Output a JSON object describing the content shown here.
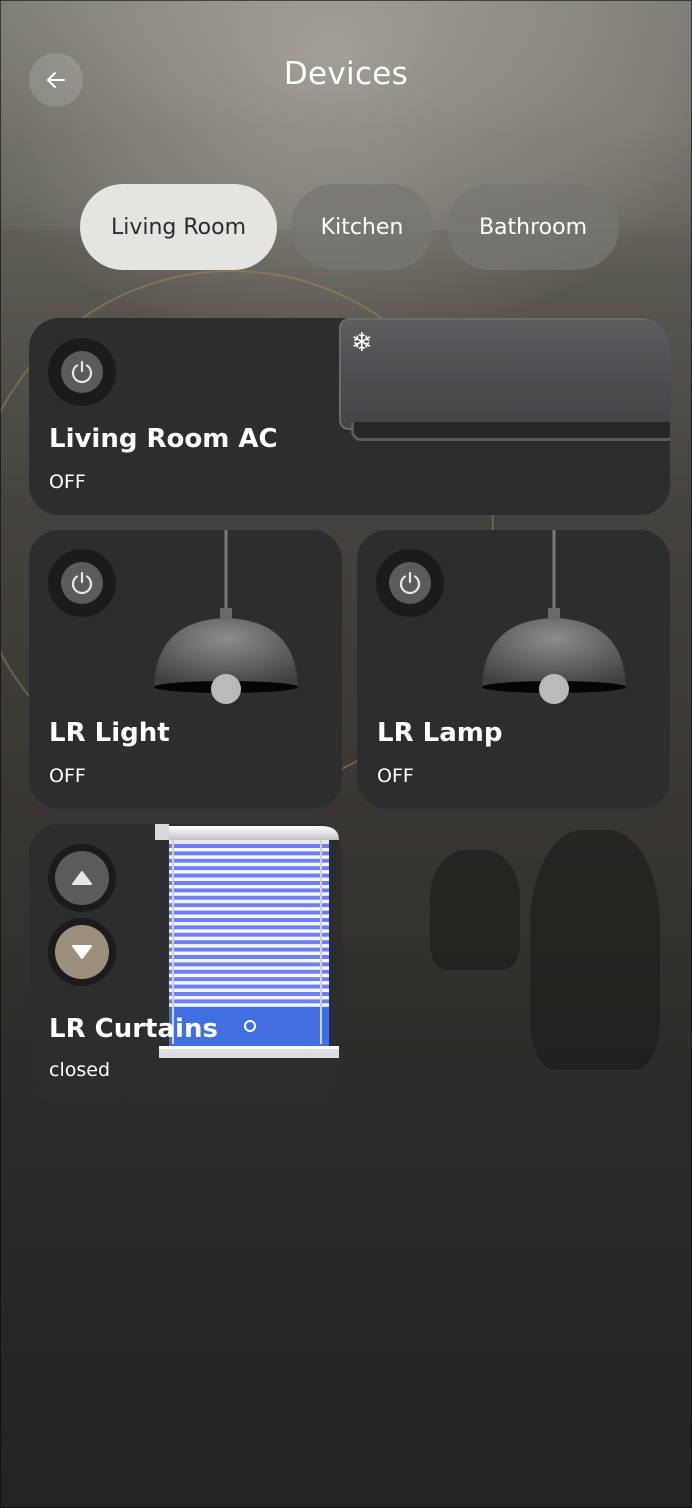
{
  "header": {
    "title": "Devices"
  },
  "tabs": [
    {
      "label": "Living Room",
      "active": true
    },
    {
      "label": "Kitchen",
      "active": false
    },
    {
      "label": "Bathroom",
      "active": false
    }
  ],
  "devices": {
    "ac": {
      "name": "Living Room AC",
      "state": "OFF",
      "icon": "snowflake-icon"
    },
    "light": {
      "name": "LR Light",
      "state": "OFF",
      "icon": "pendant-lamp-icon"
    },
    "lamp": {
      "name": "LR Lamp",
      "state": "OFF",
      "icon": "pendant-lamp-icon"
    },
    "curtains": {
      "name": "LR Curtains",
      "state": "closed",
      "icon": "window-blind-icon"
    }
  },
  "colors": {
    "card": "#2c2d2f",
    "active_tab": "#e6e4e0",
    "inactive_tab": "#787672",
    "curtain_down_button": "#9c8f7c",
    "blind_slat": "#6f7ef0"
  }
}
